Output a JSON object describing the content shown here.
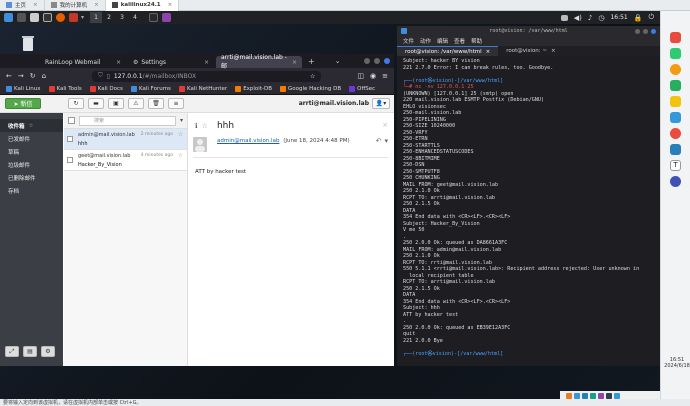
{
  "host_tabs": [
    {
      "label": "主页",
      "active": false
    },
    {
      "label": "我的计算机",
      "active": false
    },
    {
      "label": "kalilinux24.1",
      "active": true
    }
  ],
  "kali_panel": {
    "workspaces": [
      "1",
      "2",
      "3",
      "4"
    ],
    "clock": "16:51"
  },
  "firefox": {
    "tabs": [
      {
        "label": "RainLoop Webmail",
        "active": false
      },
      {
        "label": "Settings",
        "active": false
      },
      {
        "label": "arrti@mail.vision.lab - 邮",
        "active": true
      }
    ],
    "url_prefix": "127.0.0.1",
    "url_path": "/#/mailbox/INBOX",
    "bookmarks": [
      {
        "label": "Kali Linux",
        "color": "#3e8ede"
      },
      {
        "label": "Kali Tools",
        "color": "#e53935"
      },
      {
        "label": "Kali Docs",
        "color": "#e53935"
      },
      {
        "label": "Kali Forums",
        "color": "#3e8ede"
      },
      {
        "label": "Kali NetHunter",
        "color": "#e53935"
      },
      {
        "label": "Exploit-DB",
        "color": "#f57c00"
      },
      {
        "label": "Google Hacking DB",
        "color": "#f57c00"
      },
      {
        "label": "OffSec",
        "color": "#6a3bd1"
      }
    ]
  },
  "rainloop": {
    "compose_label": "➤ 新信",
    "account": "arrti@mail.vision.lab",
    "search_placeholder": "搜索",
    "folders": [
      {
        "label": "收件箱",
        "active": true
      },
      {
        "label": "已发邮件",
        "active": false
      },
      {
        "label": "草稿",
        "active": false
      },
      {
        "label": "垃圾邮件",
        "active": false
      },
      {
        "label": "已删除邮件",
        "active": false
      },
      {
        "label": "存档",
        "active": false
      }
    ],
    "messages": [
      {
        "from": "admin@mail.vision.lab",
        "subject": "hhh",
        "time": "2 minutes ago",
        "selected": true
      },
      {
        "from": "geet@mail.vision.lab",
        "subject": "Hacker_By_Vision",
        "time": "4 minutes ago",
        "selected": false
      }
    ],
    "view": {
      "subject": "hhh",
      "from": "admin@mail.vision.lab",
      "date": "(June 18, 2024 4:48 PM)",
      "body": "ATT by hacker test"
    }
  },
  "terminal": {
    "window_title": "root@vision: /var/www/html",
    "menu": [
      "文件",
      "动作",
      "编辑",
      "查看",
      "帮助"
    ],
    "tabs": [
      {
        "label": "root@vision: /var/www/html",
        "active": true
      },
      {
        "label": "root@vision: ~",
        "active": false
      }
    ],
    "lines": [
      "Subject: hacker BY vision",
      "221 2.7.0 Error: I can break rules, too. Goodbye.",
      "",
      "┌──(root㉿vision)-[/var/www/html]",
      "└─# nc -nv 127.0.0.1 25",
      "(UNKNOWN) [127.0.0.1] 25 (smtp) open",
      "220 mail.vision.lab ESMTP Postfix (Debian/GNU)",
      "EHLO visionsec",
      "250-mail.vision.lab",
      "250-PIPELINING",
      "250-SIZE 10240000",
      "250-VRFY",
      "250-ETRN",
      "250-STARTTLS",
      "250-ENHANCEDSTATUSCODES",
      "250-8BITMIME",
      "250-DSN",
      "250-SMTPUTF8",
      "250 CHUNKING",
      "MAIL FROM: geet@mail.vision.lab",
      "250 2.1.0 Ok",
      "RCPT TO: arrti@mail.vision.lab",
      "250 2.1.5 Ok",
      "DATA",
      "354 End data with <CR><LF>.<CR><LF>",
      "Subject: Hacker_By_Vision",
      "V me 50",
      ".",
      "250 2.0.0 Ok: queued as DA8661A3FC",
      "MAIL FROM: admin@mail.vision.lab",
      "250 2.1.0 Ok",
      "RCPT TO: rrti@mail.vision.lab",
      "550 5.1.1 <rrti@mail.vision.lab>: Recipient address rejected: User unknown in",
      "  local recipient table",
      "RCPT TO: arrti@mail.vision.lab",
      "250 2.1.5 Ok",
      "DATA",
      "354 End data with <CR><LF>.<CR><LF>",
      "Subject: hhh",
      "ATT by hacker test",
      ".",
      "250 2.0.0 Ok: queued as EB39E12A3FC",
      "quit",
      "221 2.0.0 Bye",
      "",
      "┌──(root㉿vision)-[/var/www/html]",
      "└─# "
    ]
  },
  "taskbar": {
    "time": "16:51",
    "date": "2024/6/18"
  },
  "vm_status": "要将输入定向到该虚拟机，请在虚拟机内部单击或按 Ctrl+G。"
}
